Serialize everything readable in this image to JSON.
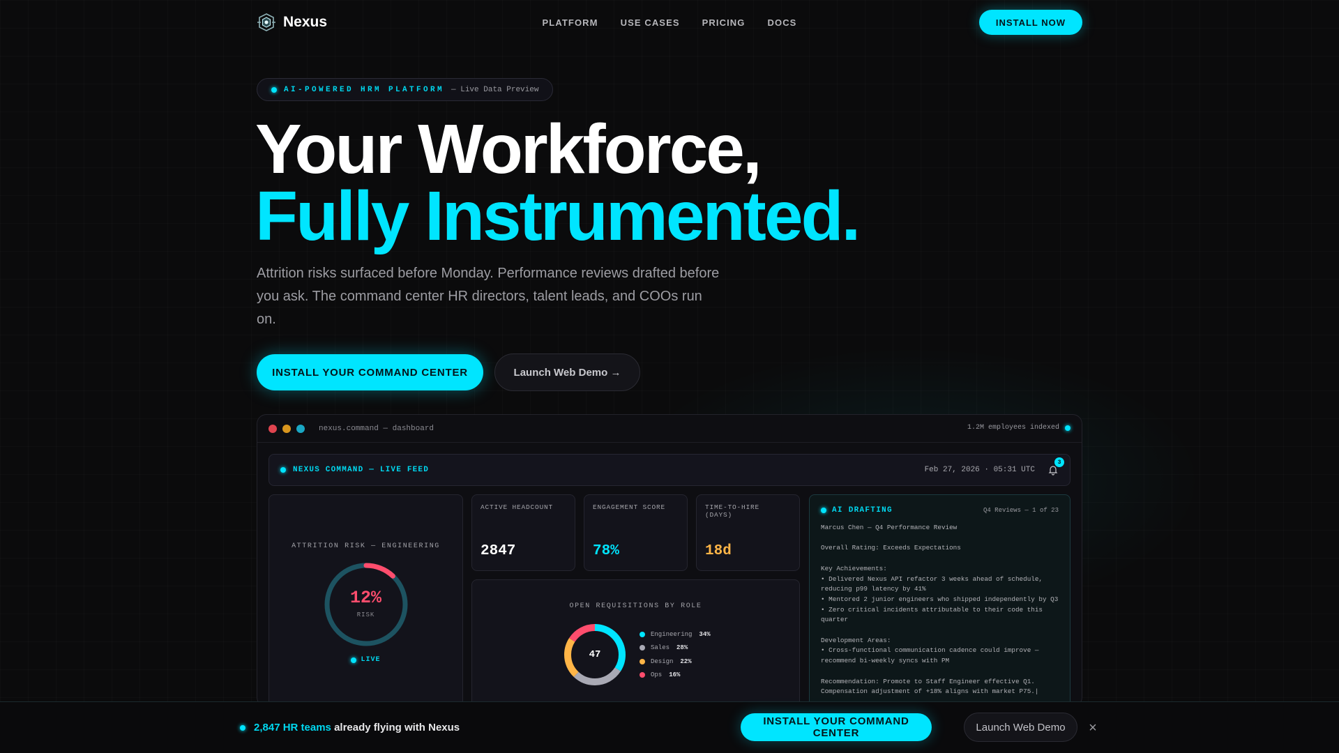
{
  "brand": {
    "name": "Nexus"
  },
  "nav": {
    "links": [
      "PLATFORM",
      "USE CASES",
      "PRICING",
      "DOCS"
    ],
    "cta": "INSTALL NOW"
  },
  "hero": {
    "pill_main": "AI-POWERED HRM PLATFORM",
    "pill_sub": "— Live Data Preview",
    "headline_1": "Your Workforce,",
    "headline_2": "Fully Instrumented.",
    "subtitle": "Attrition risks surfaced before Monday. Performance reviews drafted before you ask. The command center HR directors, talent leads, and COOs run on.",
    "primary_cta": "INSTALL YOUR COMMAND CENTER",
    "secondary_cta": "Launch Web Demo →"
  },
  "dashboard": {
    "url": "nexus.command — dashboard",
    "indexed": "1.2M employees indexed",
    "feed_title": "NEXUS COMMAND — LIVE FEED",
    "timestamp": "Feb 27, 2026 · 05:31 UTC",
    "notifications": "3",
    "attrition": {
      "title": "ATTRITION RISK — ENGINEERING",
      "value": "12%",
      "value_num": 12,
      "label": "RISK",
      "status": "LIVE"
    },
    "metrics": [
      {
        "label": "ACTIVE HEADCOUNT",
        "value": "2847",
        "color": "#ffffff"
      },
      {
        "label": "ENGAGEMENT SCORE",
        "value": "78%",
        "color": "#00e5ff"
      },
      {
        "label": "TIME-TO-HIRE (DAYS)",
        "value": "18d",
        "color": "#ffb547"
      }
    ],
    "requisitions": {
      "title": "OPEN REQUISITIONS BY ROLE",
      "total": "47",
      "roles": [
        {
          "name": "Engineering",
          "pct": "34%",
          "value": 34,
          "color": "#00e5ff"
        },
        {
          "name": "Sales",
          "pct": "28%",
          "value": 28,
          "color": "#a9a9b4"
        },
        {
          "name": "Design",
          "pct": "22%",
          "value": 22,
          "color": "#ffb547"
        },
        {
          "name": "Ops",
          "pct": "16%",
          "value": 16,
          "color": "#ff4d6d"
        }
      ]
    },
    "ai": {
      "title": "AI DRAFTING",
      "meta": "Q4 Reviews — 1 of 23",
      "body": "Marcus Chen — Q4 Performance Review\n\nOverall Rating: Exceeds Expectations\n\nKey Achievements:\n• Delivered Nexus API refactor 3 weeks ahead of schedule, reducing p99 latency by 41%\n• Mentored 2 junior engineers who shipped independently by Q3\n• Zero critical incidents attributable to their code this quarter\n\nDevelopment Areas:\n• Cross-functional communication cadence could improve — recommend bi-weekly syncs with PM\n\nRecommendation: Promote to Staff Engineer effective Q1. Compensation adjustment of +18% aligns with market P75.|"
    }
  },
  "sticky": {
    "count": "2,847 HR teams",
    "rest": "already flying with Nexus",
    "primary_cta": "INSTALL YOUR COMMAND CENTER",
    "secondary_cta": "Launch Web Demo",
    "close": "×"
  },
  "colors": {
    "accent": "#00e5ff",
    "danger": "#ff4d6d",
    "warning": "#ffb547",
    "background": "#0b0b0c"
  }
}
